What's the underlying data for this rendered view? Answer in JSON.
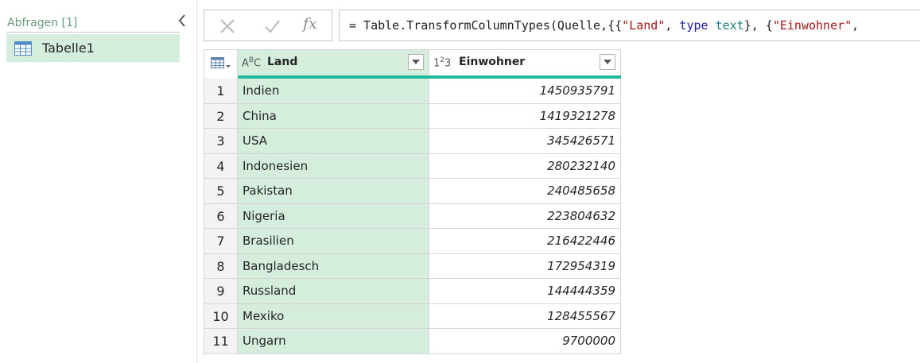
{
  "queries": {
    "title": "Abfragen [1]",
    "items": [
      {
        "label": "Tabelle1",
        "icon": "table-icon"
      }
    ]
  },
  "formula_bar": {
    "cancel_icon": "close-icon",
    "commit_icon": "checkmark-icon",
    "fx_label": "fx",
    "tokens": [
      {
        "t": "= Table.TransformColumnTypes(Quelle,{{",
        "c": ""
      },
      {
        "t": "\"Land\"",
        "c": "tk-str"
      },
      {
        "t": ", ",
        "c": ""
      },
      {
        "t": "type",
        "c": "tk-kw"
      },
      {
        "t": " ",
        "c": ""
      },
      {
        "t": "text",
        "c": "tk-type"
      },
      {
        "t": "}, {",
        "c": ""
      },
      {
        "t": "\"Einwohner\"",
        "c": "tk-str"
      },
      {
        "t": ",",
        "c": ""
      }
    ]
  },
  "grid": {
    "columns": [
      {
        "name": "Land",
        "type_label": "ABC",
        "type_icon": "text-type-icon"
      },
      {
        "name": "Einwohner",
        "type_label": "123",
        "type_icon": "number-type-icon"
      }
    ],
    "rows": [
      {
        "n": "1",
        "land": "Indien",
        "pop": "1450935791"
      },
      {
        "n": "2",
        "land": "China",
        "pop": "1419321278"
      },
      {
        "n": "3",
        "land": "USA",
        "pop": "345426571"
      },
      {
        "n": "4",
        "land": "Indonesien",
        "pop": "280232140"
      },
      {
        "n": "5",
        "land": "Pakistan",
        "pop": "240485658"
      },
      {
        "n": "6",
        "land": "Nigeria",
        "pop": "223804632"
      },
      {
        "n": "7",
        "land": "Brasilien",
        "pop": "216422446"
      },
      {
        "n": "8",
        "land": "Bangladesch",
        "pop": "172954319"
      },
      {
        "n": "9",
        "land": "Russland",
        "pop": "144444359"
      },
      {
        "n": "10",
        "land": "Mexiko",
        "pop": "128455567"
      },
      {
        "n": "11",
        "land": "Ungarn",
        "pop": "9700000"
      }
    ]
  },
  "colors": {
    "selected_bg": "#d4eddd",
    "quality_bar": "#1fb99c",
    "query_title": "#6a9a7c"
  }
}
